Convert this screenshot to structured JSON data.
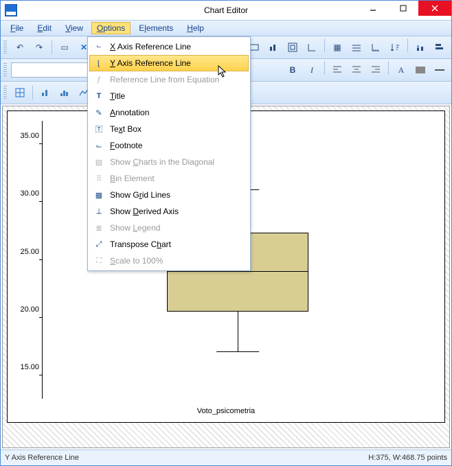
{
  "title": "Chart Editor",
  "menus": {
    "file": "File",
    "edit": "Edit",
    "view": "View",
    "options": "Options",
    "elements": "Elements",
    "help": "Help"
  },
  "options_menu": {
    "x_ref": "X Axis Reference Line",
    "y_ref": "Y Axis Reference Line",
    "eq_ref": "Reference Line from Equation",
    "title": "Title",
    "annotation": "Annotation",
    "textbox": "Text Box",
    "footnote": "Footnote",
    "diag": "Show Charts in the Diagonal",
    "bin": "Bin Element",
    "grid": "Show Grid Lines",
    "derived": "Show Derived Axis",
    "legend": "Show Legend",
    "transpose": "Transpose Chart",
    "scale": "Scale to 100%"
  },
  "status": {
    "left": "Y Axis Reference Line",
    "right": "H:375, W:468.75 points"
  },
  "chart_data": {
    "type": "boxplot",
    "xlabel": "Voto_psicometria",
    "ylabel": "",
    "ylim": [
      13,
      37
    ],
    "y_ticks": [
      15.0,
      20.0,
      25.0,
      30.0,
      35.0
    ],
    "y_tick_labels": [
      "15.00",
      "20.00",
      "25.00",
      "30.00",
      "35.00"
    ],
    "box": {
      "q1": 20.5,
      "median": 24.0,
      "q3": 27.2,
      "whisker_low": 17.0,
      "whisker_high": 31.0
    }
  },
  "colors": {
    "box_fill": "#d8ce93",
    "accent": "#4c8bd7",
    "highlight": "#ffd24d"
  }
}
